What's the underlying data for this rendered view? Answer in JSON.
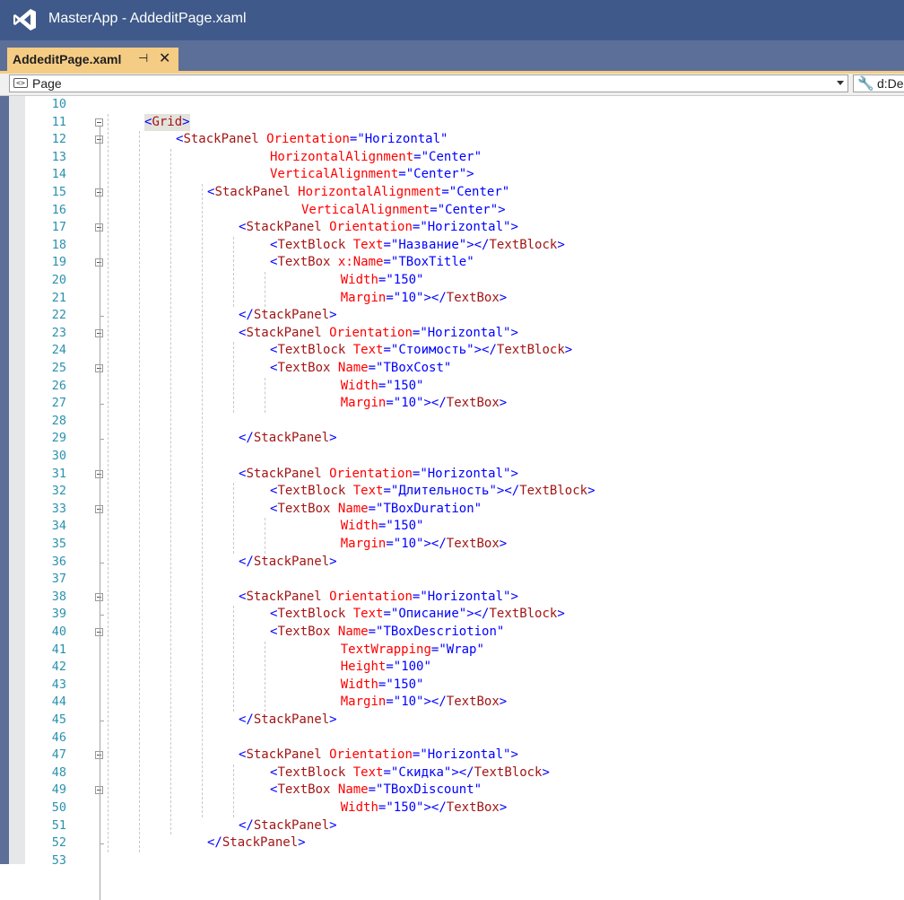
{
  "window": {
    "title": "MasterApp - AddeditPage.xaml"
  },
  "tab": {
    "label": "AddeditPage.xaml",
    "pin_glyph": "⊣",
    "close_glyph": "✕"
  },
  "navbar": {
    "scope_label": "Page",
    "member_label": "d:De"
  },
  "colors": {
    "titlebar": "#3f5a8a",
    "tab_active": "#f5cc84",
    "line_number": "#2b91af",
    "bracket": "#0000ff",
    "element": "#a31515",
    "attribute": "#ff0000",
    "value": "#0000ff"
  },
  "editor": {
    "lines": [
      {
        "n": "10",
        "indent": 0,
        "tokens": []
      },
      {
        "n": "11",
        "indent": 4,
        "tokens": [
          [
            "b",
            "<"
          ],
          [
            "e",
            "Grid"
          ],
          [
            "b",
            ">"
          ]
        ]
      },
      {
        "n": "12",
        "indent": 8,
        "tokens": [
          [
            "b",
            "<"
          ],
          [
            "e",
            "StackPanel"
          ],
          [
            "t",
            " "
          ],
          [
            "a",
            "Orientation"
          ],
          [
            "b",
            "="
          ],
          [
            "v",
            "\"Horizontal\""
          ]
        ]
      },
      {
        "n": "13",
        "indent": 20,
        "tokens": [
          [
            "a",
            "HorizontalAlignment"
          ],
          [
            "b",
            "="
          ],
          [
            "v",
            "\"Center\""
          ]
        ]
      },
      {
        "n": "14",
        "indent": 20,
        "tokens": [
          [
            "a",
            "VerticalAlignment"
          ],
          [
            "b",
            "="
          ],
          [
            "v",
            "\"Center\""
          ],
          [
            "b",
            ">"
          ]
        ]
      },
      {
        "n": "15",
        "indent": 12,
        "tokens": [
          [
            "b",
            "<"
          ],
          [
            "e",
            "StackPanel"
          ],
          [
            "t",
            " "
          ],
          [
            "a",
            "HorizontalAlignment"
          ],
          [
            "b",
            "="
          ],
          [
            "v",
            "\"Center\""
          ]
        ]
      },
      {
        "n": "16",
        "indent": 24,
        "tokens": [
          [
            "a",
            "VerticalAlignment"
          ],
          [
            "b",
            "="
          ],
          [
            "v",
            "\"Center\""
          ],
          [
            "b",
            ">"
          ]
        ]
      },
      {
        "n": "17",
        "indent": 16,
        "tokens": [
          [
            "b",
            "<"
          ],
          [
            "e",
            "StackPanel"
          ],
          [
            "t",
            " "
          ],
          [
            "a",
            "Orientation"
          ],
          [
            "b",
            "="
          ],
          [
            "v",
            "\"Horizontal\""
          ],
          [
            "b",
            ">"
          ]
        ]
      },
      {
        "n": "18",
        "indent": 20,
        "tokens": [
          [
            "b",
            "<"
          ],
          [
            "e",
            "TextBlock"
          ],
          [
            "t",
            " "
          ],
          [
            "a",
            "Text"
          ],
          [
            "b",
            "="
          ],
          [
            "v",
            "\"Название\""
          ],
          [
            "b",
            "></"
          ],
          [
            "e",
            "TextBlock"
          ],
          [
            "b",
            ">"
          ]
        ]
      },
      {
        "n": "19",
        "indent": 20,
        "tokens": [
          [
            "b",
            "<"
          ],
          [
            "e",
            "TextBox"
          ],
          [
            "t",
            " "
          ],
          [
            "a",
            "x:Name"
          ],
          [
            "b",
            "="
          ],
          [
            "v",
            "\"TBoxTitle\""
          ]
        ]
      },
      {
        "n": "20",
        "indent": 29,
        "tokens": [
          [
            "a",
            "Width"
          ],
          [
            "b",
            "="
          ],
          [
            "v",
            "\"150\""
          ]
        ]
      },
      {
        "n": "21",
        "indent": 29,
        "tokens": [
          [
            "a",
            "Margin"
          ],
          [
            "b",
            "="
          ],
          [
            "v",
            "\"10\""
          ],
          [
            "b",
            "></"
          ],
          [
            "e",
            "TextBox"
          ],
          [
            "b",
            ">"
          ]
        ]
      },
      {
        "n": "22",
        "indent": 16,
        "tokens": [
          [
            "b",
            "</"
          ],
          [
            "e",
            "StackPanel"
          ],
          [
            "b",
            ">"
          ]
        ]
      },
      {
        "n": "23",
        "indent": 16,
        "tokens": [
          [
            "b",
            "<"
          ],
          [
            "e",
            "StackPanel"
          ],
          [
            "t",
            " "
          ],
          [
            "a",
            "Orientation"
          ],
          [
            "b",
            "="
          ],
          [
            "v",
            "\"Horizontal\""
          ],
          [
            "b",
            ">"
          ]
        ]
      },
      {
        "n": "24",
        "indent": 20,
        "tokens": [
          [
            "b",
            "<"
          ],
          [
            "e",
            "TextBlock"
          ],
          [
            "t",
            " "
          ],
          [
            "a",
            "Text"
          ],
          [
            "b",
            "="
          ],
          [
            "v",
            "\"Стоимость\""
          ],
          [
            "b",
            "></"
          ],
          [
            "e",
            "TextBlock"
          ],
          [
            "b",
            ">"
          ]
        ]
      },
      {
        "n": "25",
        "indent": 20,
        "tokens": [
          [
            "b",
            "<"
          ],
          [
            "e",
            "TextBox"
          ],
          [
            "t",
            " "
          ],
          [
            "a",
            "Name"
          ],
          [
            "b",
            "="
          ],
          [
            "v",
            "\"TBoxCost\""
          ]
        ]
      },
      {
        "n": "26",
        "indent": 29,
        "tokens": [
          [
            "a",
            "Width"
          ],
          [
            "b",
            "="
          ],
          [
            "v",
            "\"150\""
          ]
        ]
      },
      {
        "n": "27",
        "indent": 29,
        "tokens": [
          [
            "a",
            "Margin"
          ],
          [
            "b",
            "="
          ],
          [
            "v",
            "\"10\""
          ],
          [
            "b",
            "></"
          ],
          [
            "e",
            "TextBox"
          ],
          [
            "b",
            ">"
          ]
        ]
      },
      {
        "n": "28",
        "indent": 0,
        "tokens": []
      },
      {
        "n": "29",
        "indent": 16,
        "tokens": [
          [
            "b",
            "</"
          ],
          [
            "e",
            "StackPanel"
          ],
          [
            "b",
            ">"
          ]
        ]
      },
      {
        "n": "30",
        "indent": 0,
        "tokens": []
      },
      {
        "n": "31",
        "indent": 16,
        "tokens": [
          [
            "b",
            "<"
          ],
          [
            "e",
            "StackPanel"
          ],
          [
            "t",
            " "
          ],
          [
            "a",
            "Orientation"
          ],
          [
            "b",
            "="
          ],
          [
            "v",
            "\"Horizontal\""
          ],
          [
            "b",
            ">"
          ]
        ]
      },
      {
        "n": "32",
        "indent": 20,
        "tokens": [
          [
            "b",
            "<"
          ],
          [
            "e",
            "TextBlock"
          ],
          [
            "t",
            " "
          ],
          [
            "a",
            "Text"
          ],
          [
            "b",
            "="
          ],
          [
            "v",
            "\"Длительность\""
          ],
          [
            "b",
            "></"
          ],
          [
            "e",
            "TextBlock"
          ],
          [
            "b",
            ">"
          ]
        ]
      },
      {
        "n": "33",
        "indent": 20,
        "tokens": [
          [
            "b",
            "<"
          ],
          [
            "e",
            "TextBox"
          ],
          [
            "t",
            " "
          ],
          [
            "a",
            "Name"
          ],
          [
            "b",
            "="
          ],
          [
            "v",
            "\"TBoxDuration\""
          ]
        ]
      },
      {
        "n": "34",
        "indent": 29,
        "tokens": [
          [
            "a",
            "Width"
          ],
          [
            "b",
            "="
          ],
          [
            "v",
            "\"150\""
          ]
        ]
      },
      {
        "n": "35",
        "indent": 29,
        "tokens": [
          [
            "a",
            "Margin"
          ],
          [
            "b",
            "="
          ],
          [
            "v",
            "\"10\""
          ],
          [
            "b",
            "></"
          ],
          [
            "e",
            "TextBox"
          ],
          [
            "b",
            ">"
          ]
        ]
      },
      {
        "n": "36",
        "indent": 16,
        "tokens": [
          [
            "b",
            "</"
          ],
          [
            "e",
            "StackPanel"
          ],
          [
            "b",
            ">"
          ]
        ]
      },
      {
        "n": "37",
        "indent": 0,
        "tokens": []
      },
      {
        "n": "38",
        "indent": 16,
        "tokens": [
          [
            "b",
            "<"
          ],
          [
            "e",
            "StackPanel"
          ],
          [
            "t",
            " "
          ],
          [
            "a",
            "Orientation"
          ],
          [
            "b",
            "="
          ],
          [
            "v",
            "\"Horizontal\""
          ],
          [
            "b",
            ">"
          ]
        ]
      },
      {
        "n": "39",
        "indent": 20,
        "tokens": [
          [
            "b",
            "<"
          ],
          [
            "e",
            "TextBlock"
          ],
          [
            "t",
            " "
          ],
          [
            "a",
            "Text"
          ],
          [
            "b",
            "="
          ],
          [
            "v",
            "\"Описание\""
          ],
          [
            "b",
            "></"
          ],
          [
            "e",
            "TextBlock"
          ],
          [
            "b",
            ">"
          ]
        ]
      },
      {
        "n": "40",
        "indent": 20,
        "tokens": [
          [
            "b",
            "<"
          ],
          [
            "e",
            "TextBox"
          ],
          [
            "t",
            " "
          ],
          [
            "a",
            "Name"
          ],
          [
            "b",
            "="
          ],
          [
            "v",
            "\"TBoxDescriotion\""
          ]
        ]
      },
      {
        "n": "41",
        "indent": 29,
        "tokens": [
          [
            "a",
            "TextWrapping"
          ],
          [
            "b",
            "="
          ],
          [
            "v",
            "\"Wrap\""
          ]
        ]
      },
      {
        "n": "42",
        "indent": 29,
        "tokens": [
          [
            "a",
            "Height"
          ],
          [
            "b",
            "="
          ],
          [
            "v",
            "\"100\""
          ]
        ]
      },
      {
        "n": "43",
        "indent": 29,
        "tokens": [
          [
            "a",
            "Width"
          ],
          [
            "b",
            "="
          ],
          [
            "v",
            "\"150\""
          ]
        ]
      },
      {
        "n": "44",
        "indent": 29,
        "tokens": [
          [
            "a",
            "Margin"
          ],
          [
            "b",
            "="
          ],
          [
            "v",
            "\"10\""
          ],
          [
            "b",
            "></"
          ],
          [
            "e",
            "TextBox"
          ],
          [
            "b",
            ">"
          ]
        ]
      },
      {
        "n": "45",
        "indent": 16,
        "tokens": [
          [
            "b",
            "</"
          ],
          [
            "e",
            "StackPanel"
          ],
          [
            "b",
            ">"
          ]
        ]
      },
      {
        "n": "46",
        "indent": 0,
        "tokens": []
      },
      {
        "n": "47",
        "indent": 16,
        "tokens": [
          [
            "b",
            "<"
          ],
          [
            "e",
            "StackPanel"
          ],
          [
            "t",
            " "
          ],
          [
            "a",
            "Orientation"
          ],
          [
            "b",
            "="
          ],
          [
            "v",
            "\"Horizontal\""
          ],
          [
            "b",
            ">"
          ]
        ]
      },
      {
        "n": "48",
        "indent": 20,
        "tokens": [
          [
            "b",
            "<"
          ],
          [
            "e",
            "TextBlock"
          ],
          [
            "t",
            " "
          ],
          [
            "a",
            "Text"
          ],
          [
            "b",
            "="
          ],
          [
            "v",
            "\"Скидка\""
          ],
          [
            "b",
            "></"
          ],
          [
            "e",
            "TextBlock"
          ],
          [
            "b",
            ">"
          ]
        ]
      },
      {
        "n": "49",
        "indent": 20,
        "tokens": [
          [
            "b",
            "<"
          ],
          [
            "e",
            "TextBox"
          ],
          [
            "t",
            " "
          ],
          [
            "a",
            "Name"
          ],
          [
            "b",
            "="
          ],
          [
            "v",
            "\"TBoxDiscount\""
          ]
        ]
      },
      {
        "n": "50",
        "indent": 29,
        "tokens": [
          [
            "a",
            "Width"
          ],
          [
            "b",
            "="
          ],
          [
            "v",
            "\"150\""
          ],
          [
            "b",
            "></"
          ],
          [
            "e",
            "TextBox"
          ],
          [
            "b",
            ">"
          ]
        ]
      },
      {
        "n": "51",
        "indent": 16,
        "tokens": [
          [
            "b",
            "</"
          ],
          [
            "e",
            "StackPanel"
          ],
          [
            "b",
            ">"
          ]
        ]
      },
      {
        "n": "52",
        "indent": 12,
        "tokens": [
          [
            "b",
            "</"
          ],
          [
            "e",
            "StackPanel"
          ],
          [
            "b",
            ">"
          ]
        ]
      },
      {
        "n": "53",
        "indent": 0,
        "tokens": []
      }
    ]
  }
}
